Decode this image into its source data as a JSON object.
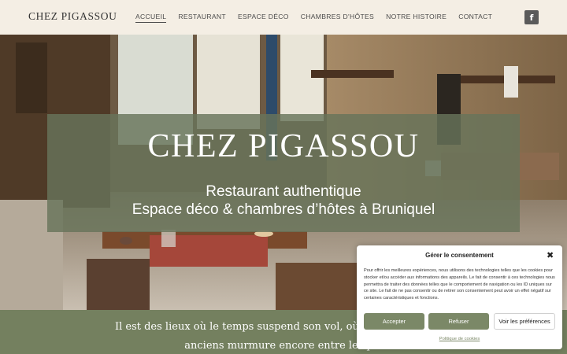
{
  "header": {
    "logo": "CHEZ PIGASSOU",
    "nav": [
      "ACCUEIL",
      "RESTAURANT",
      "ESPACE DÉCO",
      "CHAMBRES D'HÔTES",
      "NOTRE HISTOIRE",
      "CONTACT"
    ],
    "facebook_glyph": "f"
  },
  "hero": {
    "title": "CHEZ PIGASSOU",
    "subtitle_line1": "Restaurant authentique",
    "subtitle_line2": "Espace déco & chambres d’hôtes à Bruniquel"
  },
  "intro": {
    "line1": "Il est des lieux où le temps suspend son vol, où chaque saveur ra",
    "line2": "anciens murmure encore entre les pie"
  },
  "consent": {
    "title": "Gérer le consentement",
    "close_glyph": "✖",
    "text": "Pour offrir les meilleures expériences, nous utilisons des technologies telles que les cookies pour stocker et/ou accéder aux informations des appareils. Le fait de consentir à ces technologies nous permettra de traiter des données telles que le comportement de navigation ou les ID uniques sur ce site. Le fait de ne pas consentir ou de retirer son consentement peut avoir un effet négatif sur certaines caractéristiques et fonctions.",
    "accept": "Accepter",
    "refuse": "Refuser",
    "preferences": "Voir les préférences",
    "policy_link": "Politique de cookies"
  },
  "colors": {
    "header_bg": "#f4eee4",
    "overlay": "#68745a",
    "band": "#74805f",
    "button": "#7b8867"
  },
  "icons": {
    "facebook": "facebook-icon",
    "close": "close-icon"
  }
}
